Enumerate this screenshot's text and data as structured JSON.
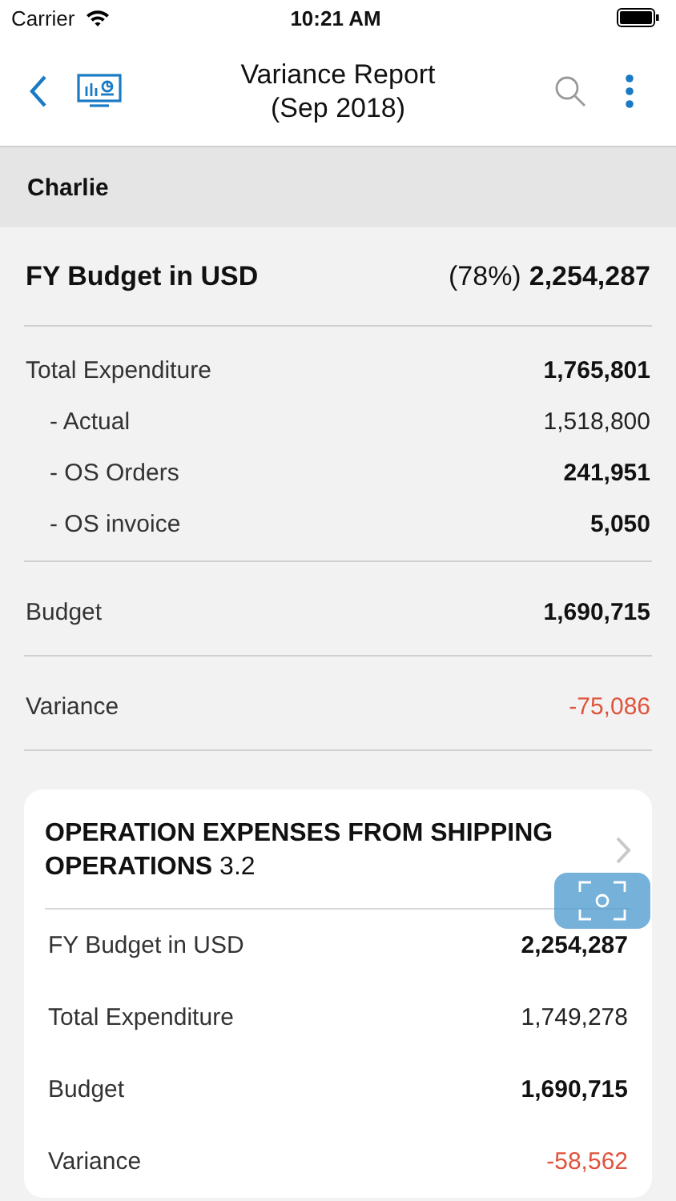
{
  "status_bar": {
    "carrier": "Carrier",
    "time": "10:21 AM"
  },
  "nav": {
    "title_lines": [
      "Variance Report",
      "(Sep 2018)"
    ]
  },
  "entity": "Charlie",
  "summary": {
    "heading": {
      "label": "FY Budget in USD",
      "percent": "(78%)",
      "value": "2,254,287"
    },
    "sections": [
      {
        "rows": [
          {
            "label": "Total Expenditure",
            "value": "1,765,801",
            "kind": "main",
            "emphasis": true,
            "negative": false
          },
          {
            "label": "- Actual",
            "value": "1,518,800",
            "kind": "sub",
            "emphasis": false,
            "negative": false
          },
          {
            "label": "- OS Orders",
            "value": "241,951",
            "kind": "sub",
            "emphasis": true,
            "negative": false
          },
          {
            "label": "- OS invoice",
            "value": "5,050",
            "kind": "sub",
            "emphasis": true,
            "negative": false
          }
        ]
      },
      {
        "rows": [
          {
            "label": "Budget",
            "value": "1,690,715",
            "kind": "main",
            "emphasis": true,
            "negative": false
          }
        ]
      },
      {
        "rows": [
          {
            "label": "Variance",
            "value": "-75,086",
            "kind": "main",
            "emphasis": false,
            "negative": true
          }
        ]
      }
    ]
  },
  "cards": [
    {
      "title": "OPERATION EXPENSES FROM SHIPPING OPERATIONS",
      "code": "3.2",
      "rows": [
        {
          "label": "FY Budget in USD",
          "value": "2,254,287",
          "emphasis": true,
          "negative": false
        },
        {
          "label": "Total Expenditure",
          "value": "1,749,278",
          "emphasis": false,
          "negative": false
        },
        {
          "label": "Budget",
          "value": "1,690,715",
          "emphasis": true,
          "negative": false
        },
        {
          "label": "Variance",
          "value": "-58,562",
          "emphasis": false,
          "negative": true
        }
      ]
    }
  ]
}
